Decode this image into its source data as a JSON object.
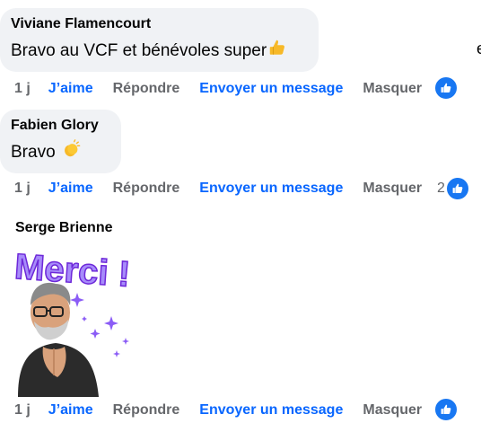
{
  "comments": [
    {
      "author": "Viviane Flamencourt",
      "text": "Bravo au VCF et bénévoles super",
      "emoji": "thumbs-up",
      "time": "1 j",
      "like_label": "J’aime",
      "reply_label": "Répondre",
      "message_label": "Envoyer un message",
      "hide_label": "Masquer",
      "reaction_count": ""
    },
    {
      "author": "Fabien Glory",
      "text": "Bravo",
      "emoji": "clapping-hands",
      "time": "1 j",
      "like_label": "J’aime",
      "reply_label": "Répondre",
      "message_label": "Envoyer un message",
      "hide_label": "Masquer",
      "reaction_count": "2"
    },
    {
      "author": "Serge Brienne",
      "sticker_text": "Merci !",
      "time": "1 j",
      "like_label": "J’aime",
      "reply_label": "Répondre",
      "message_label": "Envoyer un message",
      "hide_label": "Masquer",
      "reaction_count": ""
    }
  ],
  "edge_text": "e",
  "colors": {
    "bubble": "#f0f2f5",
    "link_blue": "#0866ff",
    "muted": "#65676b",
    "like_badge": "#1877f2",
    "sticker_purple": "#8b5cf6"
  }
}
